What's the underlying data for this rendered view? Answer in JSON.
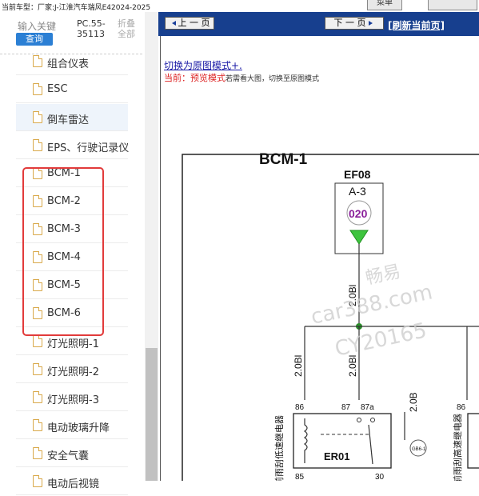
{
  "topbar": {
    "car_model": "当前车型：厂家:J-江淮汽车瑞风E42024-2025",
    "tab_label": "菜单"
  },
  "sidebar": {
    "search_hint": "输入关键",
    "query_button": "查询",
    "pc_code": "PC.55-35113",
    "fold_label": "折叠全部",
    "items": [
      {
        "label": "组合仪表"
      },
      {
        "label": "ESC"
      },
      {
        "label": "倒车雷达"
      },
      {
        "label": "EPS、行驶记录仪"
      },
      {
        "label": "BCM-1"
      },
      {
        "label": "BCM-2"
      },
      {
        "label": "BCM-3"
      },
      {
        "label": "BCM-4"
      },
      {
        "label": "BCM-5"
      },
      {
        "label": "BCM-6"
      },
      {
        "label": "灯光照明-1"
      },
      {
        "label": "灯光照明-2"
      },
      {
        "label": "灯光照明-3"
      },
      {
        "label": "电动玻璃升降"
      },
      {
        "label": "安全气囊"
      },
      {
        "label": "电动后视镜"
      }
    ]
  },
  "main": {
    "prev_button": "上 一 页",
    "next_button": "下 一 页",
    "refresh_link": "[刷新当前页]",
    "switch_link": "切换为原图模式+.",
    "current_prefix": "当前：",
    "current_mode": "预览模式",
    "current_hint": "若需看大图，切换至原图模式"
  },
  "diagram": {
    "title": "BCM-1",
    "fuse_name": "EF08",
    "fuse_pos": "A-3",
    "fuse_rating": "020",
    "wire_main": "2.0Bl",
    "wire_left": "2.0Bl",
    "wire_mid": "2.0Bl",
    "wire_right": "2.0B",
    "pin_86": "86",
    "pin_87": "87",
    "pin_87a": "87a",
    "pin_86b": "86",
    "pin_85": "85",
    "pin_30": "30",
    "relay_name": "ER01",
    "relay_label_left": "前雨刮低速继电器",
    "relay_label_right": "前雨刮高速继电器",
    "motor_label": "GB6-1",
    "watermark_1": "畅易",
    "watermark_2": "car388.com",
    "watermark_3": "CY20165",
    "colors": {
      "nav": "#173f8e",
      "accent": "#2b7fd4",
      "highlight": "#e23b3b",
      "fuse_green": "#3ec43e",
      "fuse_purple": "#8a1f9a"
    }
  }
}
